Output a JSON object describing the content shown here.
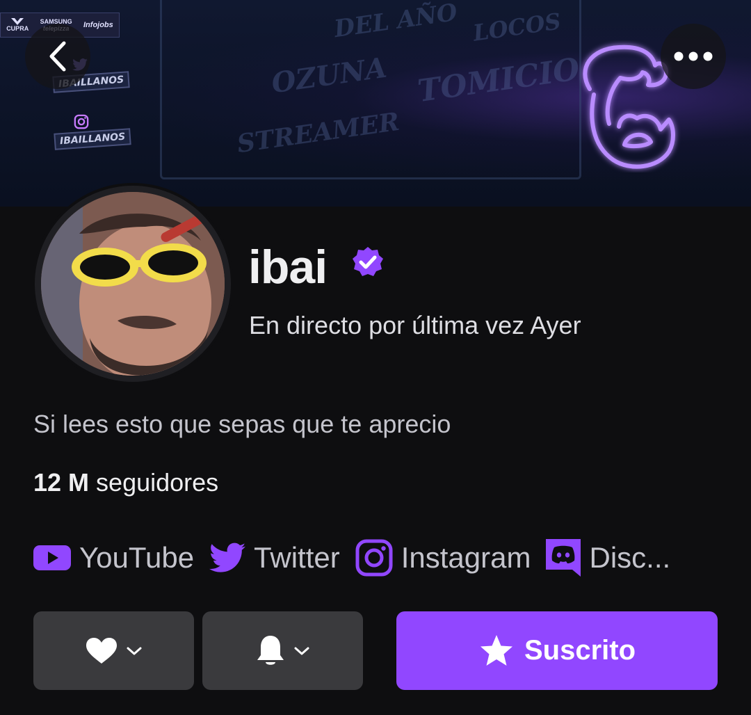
{
  "banner": {
    "sponsors": [
      "CUPRA",
      "SAMSUNG",
      "telepizza",
      "Infojobs"
    ],
    "signs": [
      "IBAILLANOS",
      "IBAILLANOS"
    ],
    "graffiti": [
      "DEL AÑO",
      "LOCOS",
      "OZUNA",
      "TOMICIO",
      "STREAMER"
    ]
  },
  "nav": {
    "back_icon": "chevron-left-icon",
    "more_icon": "more-horizontal-icon"
  },
  "profile": {
    "name": "ibai",
    "last_live": "En directo por última vez Ayer",
    "bio": "Si lees esto que sepas que te aprecio",
    "followers_count": "12 M",
    "followers_label": " seguidores"
  },
  "links": [
    {
      "label": "YouTube",
      "icon": "youtube-icon"
    },
    {
      "label": "Twitter",
      "icon": "twitter-icon"
    },
    {
      "label": "Instagram",
      "icon": "instagram-icon"
    },
    {
      "label": "Disc...",
      "icon": "discord-icon"
    }
  ],
  "actions": {
    "subscribe_label": "Suscrito",
    "follow_icon": "heart-icon",
    "notify_icon": "bell-icon"
  },
  "colors": {
    "accent": "#9147ff",
    "background": "#0e0e10",
    "button": "#3a3a3d"
  }
}
